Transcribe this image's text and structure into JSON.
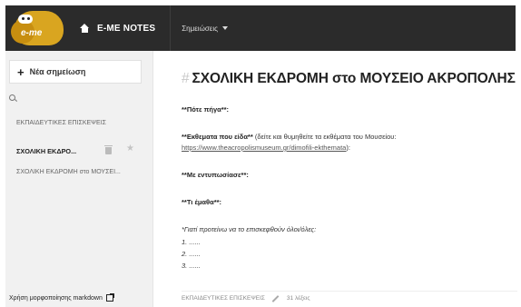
{
  "header": {
    "logo_text": "e-me",
    "home_label": "E-ME NOTES",
    "notes_menu_label": "Σημειώσεις"
  },
  "sidebar": {
    "new_note_label": "Νέα σημείωση",
    "notes": [
      {
        "title": "ΕΚΠΑΙΔΕΥΤΙΚΕΣ ΕΠΙΣΚΕΨΕΙΣ"
      },
      {
        "title": "ΣΧΟΛΙΚΗ ΕΚΔΡΟ..."
      },
      {
        "title": "ΣΧΟΛΙΚΗ ΕΚΔΡΟΜΗ στο ΜΟΥΣΕΙ..."
      }
    ],
    "markdown_help": "Χρήση μορφοποίησης markdown"
  },
  "note": {
    "title": "ΣΧΟΛΙΚΗ ΕΚΔΡΟΜΗ  στο ΜΟΥΣΕΙΟ ΑΚΡΟΠΟΛΗΣ",
    "line1": "**Πότε πήγα**:",
    "line2_bold": "**Εκθεματα που είδα**",
    "line2_rest": " (δείτε και θυμηθείτε τα εκθέματα του Μουσείου:",
    "line2_link": "https://www.theacropolismuseum.gr/dimofili-ekthemata",
    "line2_end": "):",
    "line3": "**Με εντυπωσίασε**:",
    "line4": "**Τι έμαθα**:",
    "line5": "*Γιατί προτείνω να το επισκεφθούν όλοι/όλες:",
    "list": [
      "1. ......",
      "2. ......",
      "3. ......"
    ]
  },
  "footer": {
    "category": "ΕΚΠΑΙΔΕΥΤΙΚΕΣ ΕΠΙΣΚΕΨΕΙΣ",
    "word_count": "31 λέξεις"
  }
}
